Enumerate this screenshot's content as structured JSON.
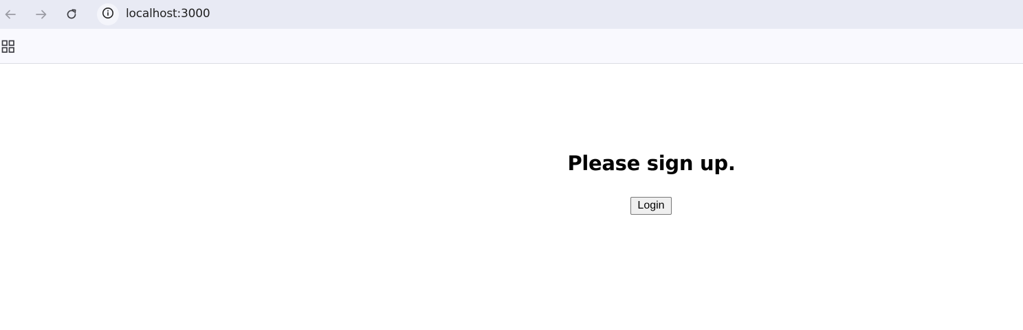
{
  "browser": {
    "url": "localhost:3000",
    "icons": {
      "back": "back-arrow-icon",
      "forward": "forward-arrow-icon",
      "reload": "reload-icon",
      "info": "info-icon",
      "apps": "apps-grid-icon"
    }
  },
  "page": {
    "heading": "Please sign up.",
    "login_label": "Login"
  }
}
